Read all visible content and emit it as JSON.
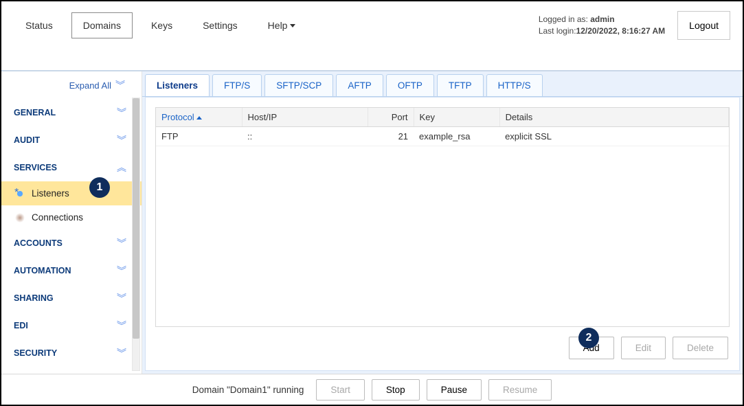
{
  "menu": {
    "status": "Status",
    "domains": "Domains",
    "keys": "Keys",
    "settings": "Settings",
    "help": "Help"
  },
  "login": {
    "prefix": "Logged in as: ",
    "user": "admin",
    "last_prefix": "Last login:",
    "last": "12/20/2022, 8:16:27 AM"
  },
  "logout": "Logout",
  "sidebar": {
    "expand_all": "Expand All",
    "groups": {
      "general": "GENERAL",
      "audit": "AUDIT",
      "services": "SERVICES",
      "accounts": "ACCOUNTS",
      "automation": "AUTOMATION",
      "sharing": "SHARING",
      "edi": "EDI",
      "security": "SECURITY"
    },
    "listeners": "Listeners",
    "connections": "Connections"
  },
  "tabs": [
    "Listeners",
    "FTP/S",
    "SFTP/SCP",
    "AFTP",
    "OFTP",
    "TFTP",
    "HTTP/S"
  ],
  "columns": {
    "protocol": "Protocol",
    "host": "Host/IP",
    "port": "Port",
    "key": "Key",
    "details": "Details"
  },
  "rows": [
    {
      "protocol": "FTP",
      "host": "::",
      "port": "21",
      "key": "example_rsa",
      "details": "explicit SSL"
    }
  ],
  "buttons": {
    "add": "Add",
    "edit": "Edit",
    "delete": "Delete"
  },
  "footer": {
    "status": "Domain \"Domain1\" running",
    "start": "Start",
    "stop": "Stop",
    "pause": "Pause",
    "resume": "Resume"
  },
  "annotations": {
    "b1": "1",
    "b2": "2"
  }
}
